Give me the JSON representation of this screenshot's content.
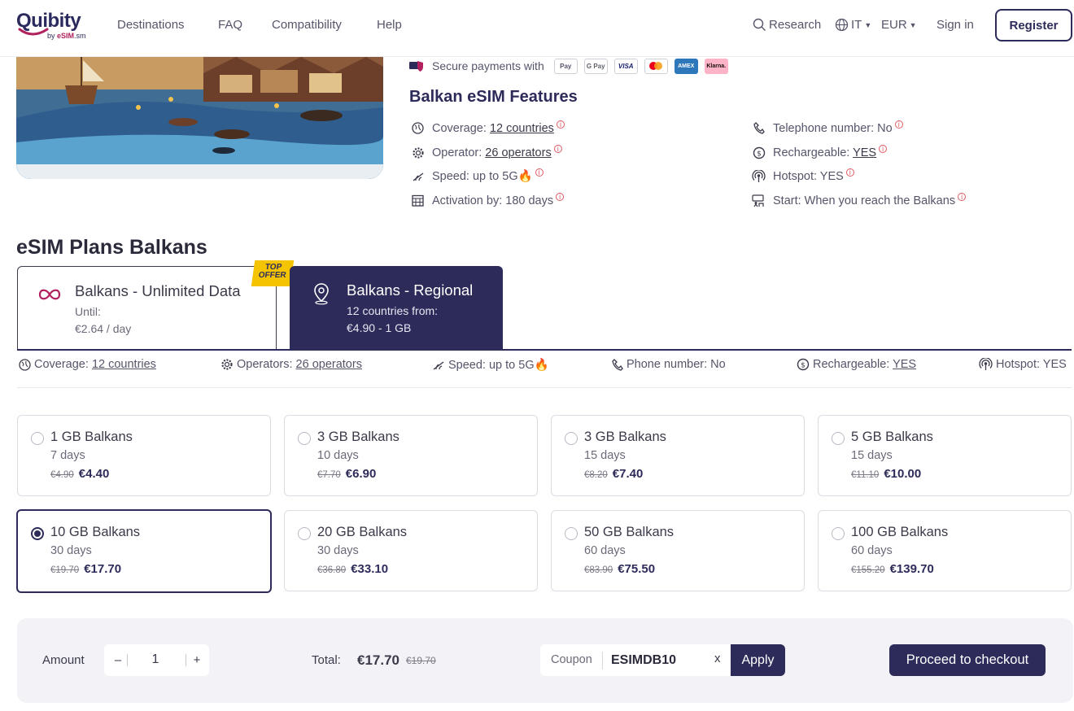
{
  "colors": {
    "brand": "#2d2b5a",
    "accent": "#b0215e",
    "info": "#e05a63",
    "offer": "#f5c400"
  },
  "header": {
    "logo": "Quibity",
    "logo_sub_prefix": "by ",
    "logo_sub_brand": "eSIM",
    "logo_sub_suffix": ".sm",
    "nav": [
      "Destinations",
      "FAQ",
      "Compatibility",
      "Help"
    ],
    "research": "Research",
    "language": "IT",
    "currency": "EUR",
    "signin": "Sign in",
    "register": "Register"
  },
  "payments": {
    "label": "Secure payments with",
    "methods": [
      "Pay",
      "G Pay",
      "VISA",
      "MC",
      "AMEX",
      "Klarna."
    ]
  },
  "features": {
    "title": "Balkan eSIM Features",
    "coverage_label": "Coverage: ",
    "coverage_value": "12 countries",
    "operator_label": "Operator: ",
    "operator_value": "26 operators",
    "speed": "Speed: up to 5G🔥",
    "activation": "Activation by: 180 days",
    "telephone": "Telephone number: No",
    "rechargeable_label": "Rechargeable: ",
    "rechargeable_value": "YES",
    "hotspot": "Hotspot: YES",
    "start": "Start: When you reach the Balkans",
    "info": "i"
  },
  "plans": {
    "title": "eSIM Plans Balkans",
    "tabs": [
      {
        "title": "Balkans - Unlimited Data",
        "line1": "Until:",
        "line2": "€2.64 / day",
        "badge": "TOP OFFER"
      },
      {
        "title": "Balkans - Regional",
        "line1": "12 countries from:",
        "line2": "€4.90 - 1 GB"
      }
    ],
    "specs": {
      "coverage_label": "Coverage: ",
      "coverage_value": "12 countries",
      "operators_label": "Operators: ",
      "operators_value": "26 operators",
      "speed": "Speed: up to 5G🔥",
      "phone": "Phone number: No",
      "rechargeable_label": "Rechargeable: ",
      "rechargeable_value": "YES",
      "hotspot": "Hotspot: YES"
    },
    "items": [
      {
        "name": "1 GB Balkans",
        "days": "7 days",
        "old": "€4.90",
        "price": "€4.40"
      },
      {
        "name": "3 GB Balkans",
        "days": "10 days",
        "old": "€7.70",
        "price": "€6.90"
      },
      {
        "name": "3 GB Balkans",
        "days": "15 days",
        "old": "€8.20",
        "price": "€7.40"
      },
      {
        "name": "5 GB Balkans",
        "days": "15 days",
        "old": "€11.10",
        "price": "€10.00"
      },
      {
        "name": "10 GB Balkans",
        "days": "30 days",
        "old": "€19.70",
        "price": "€17.70"
      },
      {
        "name": "20 GB Balkans",
        "days": "30 days",
        "old": "€36.80",
        "price": "€33.10"
      },
      {
        "name": "50 GB Balkans",
        "days": "60 days",
        "old": "€83.90",
        "price": "€75.50"
      },
      {
        "name": "100 GB Balkans",
        "days": "60 days",
        "old": "€155.20",
        "price": "€139.70"
      }
    ]
  },
  "checkout": {
    "amount_label": "Amount",
    "minus": "–",
    "plus": "+",
    "quantity": "1",
    "total_label": "Total:",
    "total": "€17.70",
    "total_old": "€19.70",
    "coupon_label": "Coupon",
    "coupon_value": "ESIMDB10",
    "clear": "x",
    "apply": "Apply",
    "proceed": "Proceed to checkout"
  }
}
